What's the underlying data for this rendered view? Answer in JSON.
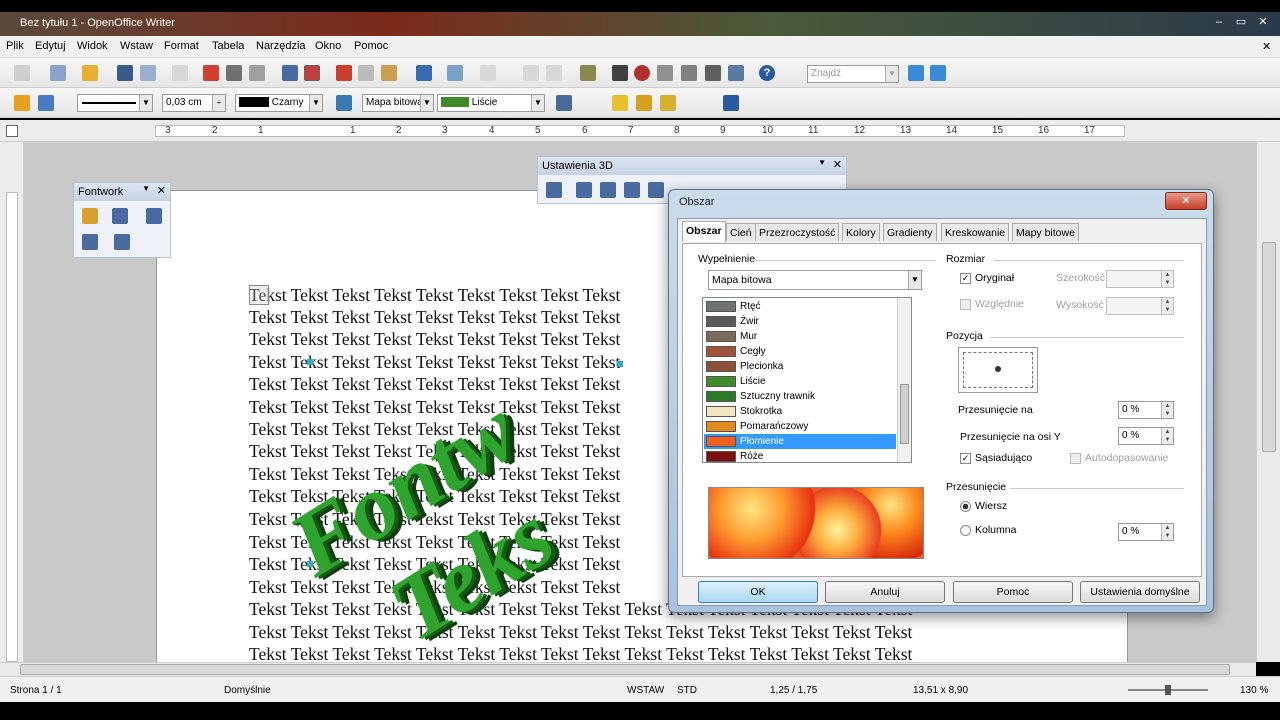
{
  "window": {
    "title": "Bez tytułu 1 - OpenOffice Writer"
  },
  "menu": [
    "Plik",
    "Edytuj",
    "Widok",
    "Wstaw",
    "Format",
    "Tabela",
    "Narzędzia",
    "Okno",
    "Pomoc"
  ],
  "toolbar_std": {
    "search_placeholder": "Znajdź"
  },
  "toolbar_draw": {
    "line_width": "0,03 cm",
    "line_color": "Czarny",
    "area_style": "Mapa bitowa",
    "area_fill": "Liście",
    "line_color_hex": "#000000"
  },
  "ruler": {
    "numbers": [
      "3",
      "2",
      "1",
      "1",
      "2",
      "3",
      "4",
      "5",
      "6",
      "7",
      "8",
      "9",
      "10",
      "11",
      "12",
      "13",
      "14",
      "15",
      "16",
      "17"
    ]
  },
  "document": {
    "line_text": "Tekst Tekst Tekst Tekst Tekst Tekst Tekst Tekst Tekst",
    "line_text_long": "Tekst Tekst Tekst Tekst Tekst Tekst Tekst Tekst Tekst Tekst Tekst Tekst Tekst Tekst Tekst Tekst",
    "fontwork_1": "Fontw",
    "fontwork_2": "Teks"
  },
  "fontwork_bar": {
    "title": "Fontwork"
  },
  "settings3d_bar": {
    "title": "Ustawienia 3D"
  },
  "dialog": {
    "title": "Obszar",
    "tabs": [
      "Obszar",
      "Cień",
      "Przezroczystość",
      "Kolory",
      "Gradienty",
      "Kreskowanie",
      "Mapy bitowe"
    ],
    "fill_group": "Wypełnienie",
    "fill_type": "Mapa bitowa",
    "bitmaps": [
      {
        "name": "Rtęć",
        "color": "#6f7470"
      },
      {
        "name": "Żwir",
        "color": "#5a5a58"
      },
      {
        "name": "Mur",
        "color": "#7a6a5a"
      },
      {
        "name": "Cegły",
        "color": "#a0523a"
      },
      {
        "name": "Plecionka",
        "color": "#8a5038"
      },
      {
        "name": "Liście",
        "color": "#3f8a2a"
      },
      {
        "name": "Sztuczny trawnik",
        "color": "#2a7a2a"
      },
      {
        "name": "Stokrotka",
        "color": "#f0e6c0"
      },
      {
        "name": "Pomarańczowy",
        "color": "#e08a20"
      },
      {
        "name": "Płomienie",
        "color": "#f06020"
      },
      {
        "name": "Róże",
        "color": "#7a1010"
      }
    ],
    "selected_bitmap": "Płomienie",
    "size_group": "Rozmiar",
    "original_label": "Oryginał",
    "relative_label": "Względnie",
    "width_label": "Szerokość",
    "height_label": "Wysokość",
    "position_group": "Pozycja",
    "offset_x_label": "Przesunięcie na",
    "offset_x_value": "0 %",
    "offset_y_label": "Przesunięcie na osi Y",
    "offset_y_value": "0 %",
    "tile_label": "Sąsiadująco",
    "autofit_label": "Autodopasowanie",
    "shift_group": "Przesunięcie",
    "row_label": "Wiersz",
    "column_label": "Kolumna",
    "shift_value": "0 %",
    "buttons": {
      "ok": "OK",
      "cancel": "Anuluj",
      "help": "Pomoc",
      "defaults": "Ustawienia domyślne"
    }
  },
  "status": {
    "page": "Strona 1 / 1",
    "style": "Domyślnie",
    "mode": "WSTAW",
    "sel": "STD",
    "pos": "1,25 / 1,75",
    "size": "13,51 x 8,90",
    "zoom": "130 %"
  }
}
